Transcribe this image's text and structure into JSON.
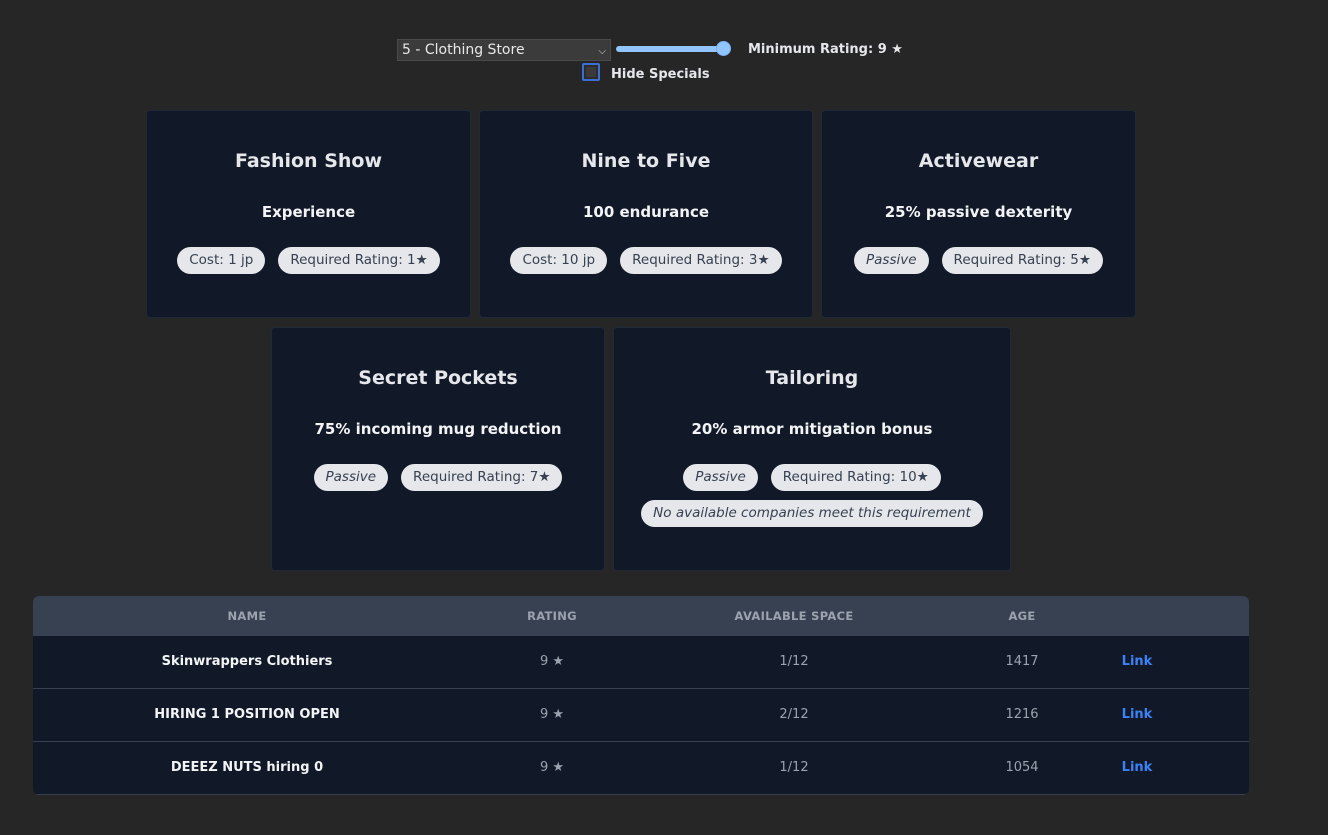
{
  "controls": {
    "company_type": "5 - Clothing Store",
    "rating_label": "Minimum Rating: 9 ★",
    "rating_value": 9,
    "rating_max": 10,
    "hide_specials_label": "Hide Specials",
    "hide_specials_checked": false
  },
  "cards": [
    {
      "title": "Fashion Show",
      "description": "Experience",
      "pills": [
        {
          "text": "Cost: 1 jp",
          "italic": false
        },
        {
          "text": "Required Rating: 1★",
          "italic": false
        }
      ],
      "warning": ""
    },
    {
      "title": "Nine to Five",
      "description": "100 endurance",
      "pills": [
        {
          "text": "Cost: 10 jp",
          "italic": false
        },
        {
          "text": "Required Rating: 3★",
          "italic": false
        }
      ],
      "warning": ""
    },
    {
      "title": "Activewear",
      "description": "25% passive dexterity",
      "pills": [
        {
          "text": "Passive",
          "italic": true
        },
        {
          "text": "Required Rating: 5★",
          "italic": false
        }
      ],
      "warning": ""
    },
    {
      "title": "Secret Pockets",
      "description": "75% incoming mug reduction",
      "pills": [
        {
          "text": "Passive",
          "italic": true
        },
        {
          "text": "Required Rating: 7★",
          "italic": false
        }
      ],
      "warning": ""
    },
    {
      "title": "Tailoring",
      "description": "20% armor mitigation bonus",
      "pills": [
        {
          "text": "Passive",
          "italic": true
        },
        {
          "text": "Required Rating: 10★",
          "italic": false
        }
      ],
      "warning": "No available companies meet this requirement"
    }
  ],
  "table": {
    "headers": [
      "NAME",
      "RATING",
      "AVAILABLE SPACE",
      "AGE"
    ],
    "rows": [
      {
        "name": "Skinwrappers Clothiers",
        "rating": "9 ★",
        "space": "1/12",
        "age": "1417",
        "link": "Link"
      },
      {
        "name": "HIRING 1 POSITION OPEN",
        "rating": "9 ★",
        "space": "2/12",
        "age": "1216",
        "link": "Link"
      },
      {
        "name": "DEEEZ NUTS hiring 0",
        "rating": "9 ★",
        "space": "1/12",
        "age": "1054",
        "link": "Link"
      }
    ]
  },
  "colors": {
    "background": "#262626",
    "card_bg": "#111827",
    "table_header_bg": "#374151",
    "accent": "#93c5fd",
    "link": "#3b82f6"
  }
}
